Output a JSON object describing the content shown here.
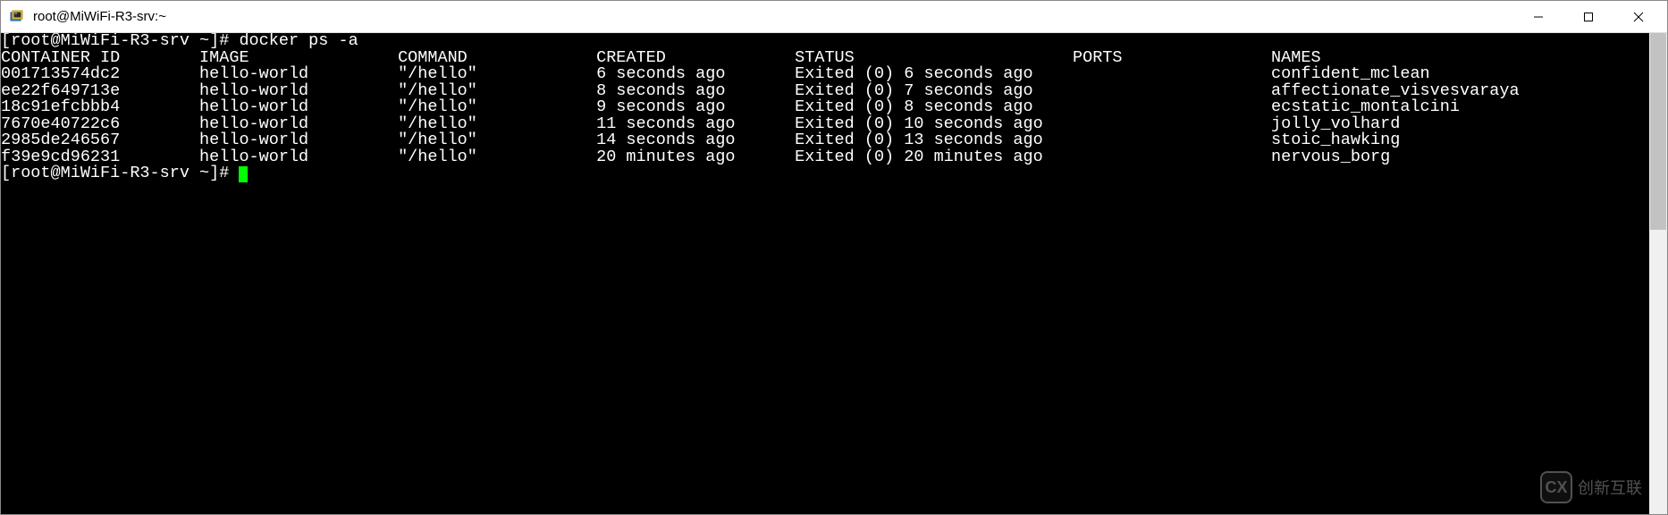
{
  "window": {
    "title": "root@MiWiFi-R3-srv:~"
  },
  "terminal": {
    "prompt": "[root@MiWiFi-R3-srv ~]# ",
    "command": "docker ps -a",
    "headers": {
      "container_id": "CONTAINER ID",
      "image": "IMAGE",
      "command": "COMMAND",
      "created": "CREATED",
      "status": "STATUS",
      "ports": "PORTS",
      "names": "NAMES"
    },
    "rows": [
      {
        "container_id": "001713574dc2",
        "image": "hello-world",
        "command": "\"/hello\"",
        "created": "6 seconds ago",
        "status": "Exited (0) 6 seconds ago",
        "ports": "",
        "names": "confident_mclean"
      },
      {
        "container_id": "ee22f649713e",
        "image": "hello-world",
        "command": "\"/hello\"",
        "created": "8 seconds ago",
        "status": "Exited (0) 7 seconds ago",
        "ports": "",
        "names": "affectionate_visvesvaraya"
      },
      {
        "container_id": "18c91efcbbb4",
        "image": "hello-world",
        "command": "\"/hello\"",
        "created": "9 seconds ago",
        "status": "Exited (0) 8 seconds ago",
        "ports": "",
        "names": "ecstatic_montalcini"
      },
      {
        "container_id": "7670e40722c6",
        "image": "hello-world",
        "command": "\"/hello\"",
        "created": "11 seconds ago",
        "status": "Exited (0) 10 seconds ago",
        "ports": "",
        "names": "jolly_volhard"
      },
      {
        "container_id": "2985de246567",
        "image": "hello-world",
        "command": "\"/hello\"",
        "created": "14 seconds ago",
        "status": "Exited (0) 13 seconds ago",
        "ports": "",
        "names": "stoic_hawking"
      },
      {
        "container_id": "f39e9cd96231",
        "image": "hello-world",
        "command": "\"/hello\"",
        "created": "20 minutes ago",
        "status": "Exited (0) 20 minutes ago",
        "ports": "",
        "names": "nervous_borg"
      }
    ],
    "prompt2": "[root@MiWiFi-R3-srv ~]# "
  },
  "watermark": {
    "logo": "CX",
    "text": "创新互联"
  },
  "columns": {
    "container_id": 20,
    "image": 20,
    "command": 20,
    "created": 20,
    "status": 28,
    "ports": 20,
    "names": 0
  }
}
